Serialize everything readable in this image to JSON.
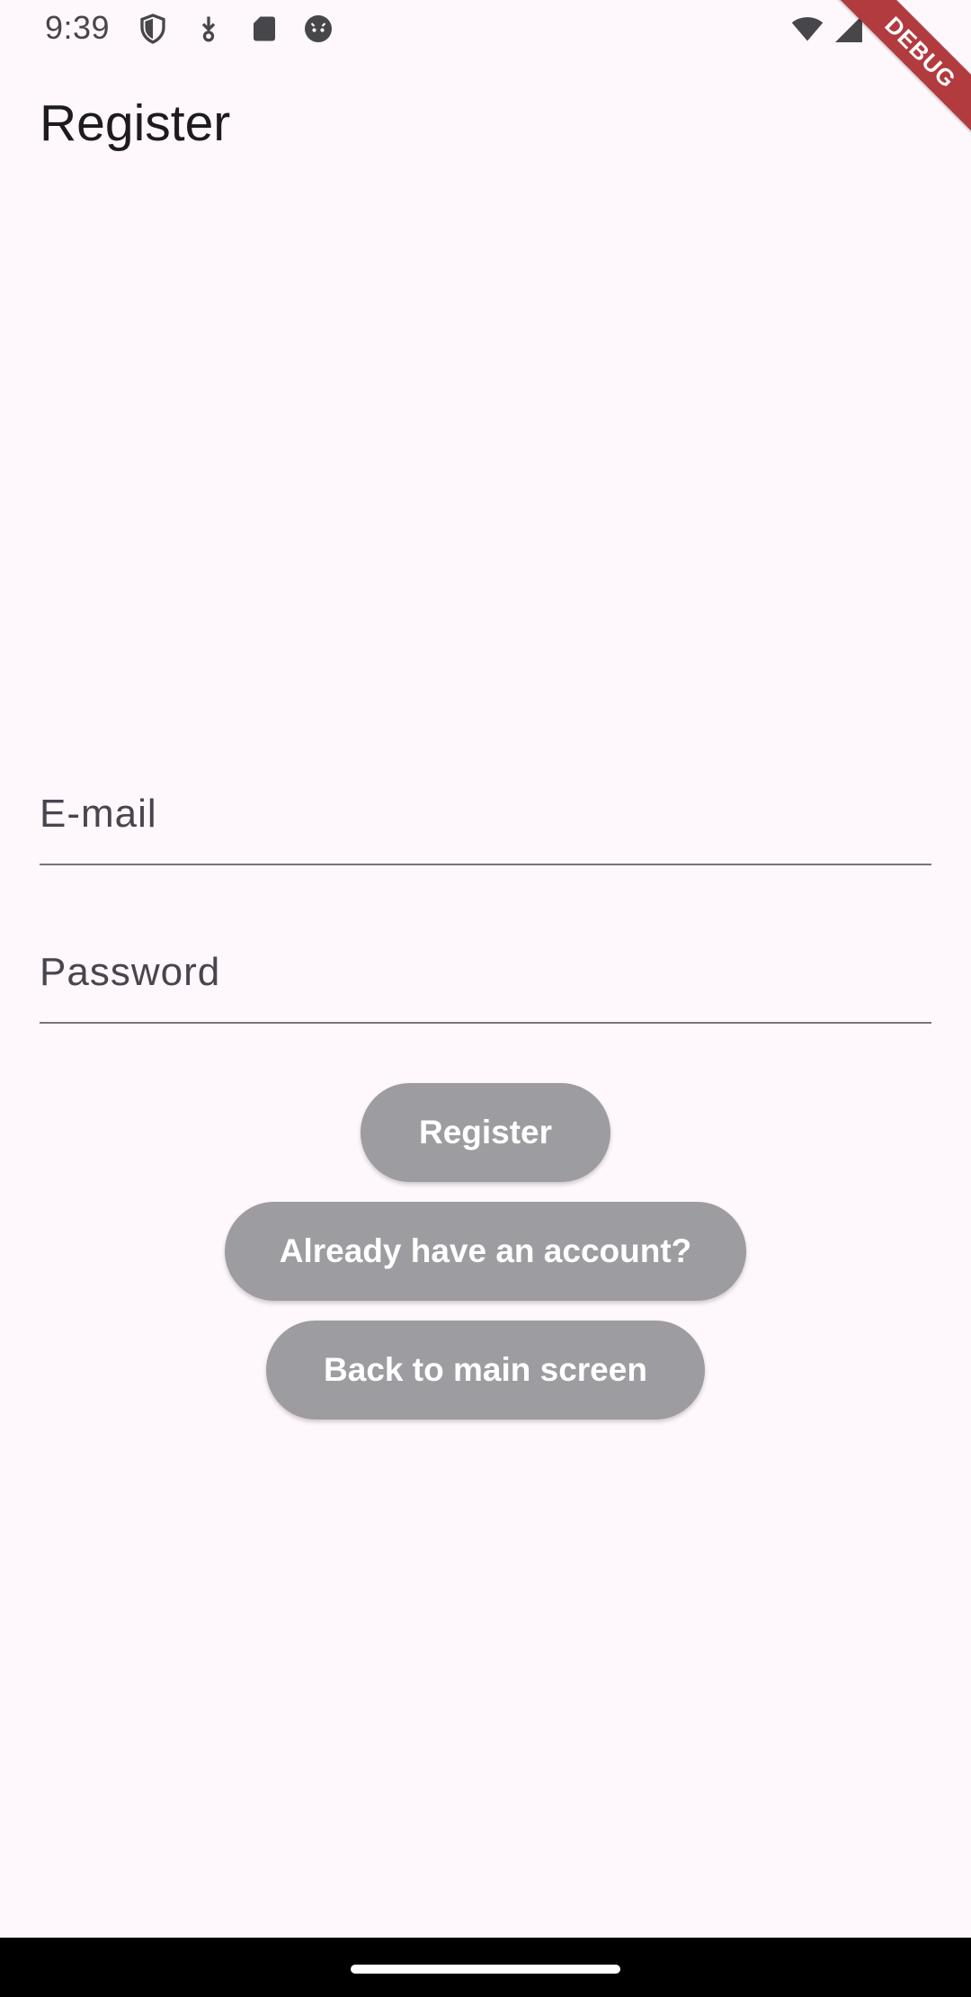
{
  "status_bar": {
    "time": "9:39",
    "left_icons": [
      "shield-icon",
      "download-icon",
      "sd-card-icon",
      "android-face-icon"
    ],
    "right_icons": [
      "wifi-icon",
      "signal-icon",
      "battery-icon"
    ]
  },
  "debug_banner": {
    "label": "DEBUG"
  },
  "app_bar": {
    "title": "Register"
  },
  "form": {
    "email": {
      "placeholder": "E-mail",
      "value": ""
    },
    "password": {
      "placeholder": "Password",
      "value": ""
    }
  },
  "buttons": {
    "register": "Register",
    "already_have_account": "Already have an account?",
    "back_to_main": "Back to main screen"
  },
  "colors": {
    "background": "#fef7fb",
    "button_disabled": "#9d9ca0",
    "debug_banner": "#b23b3f",
    "field_underline": "#79747e"
  }
}
